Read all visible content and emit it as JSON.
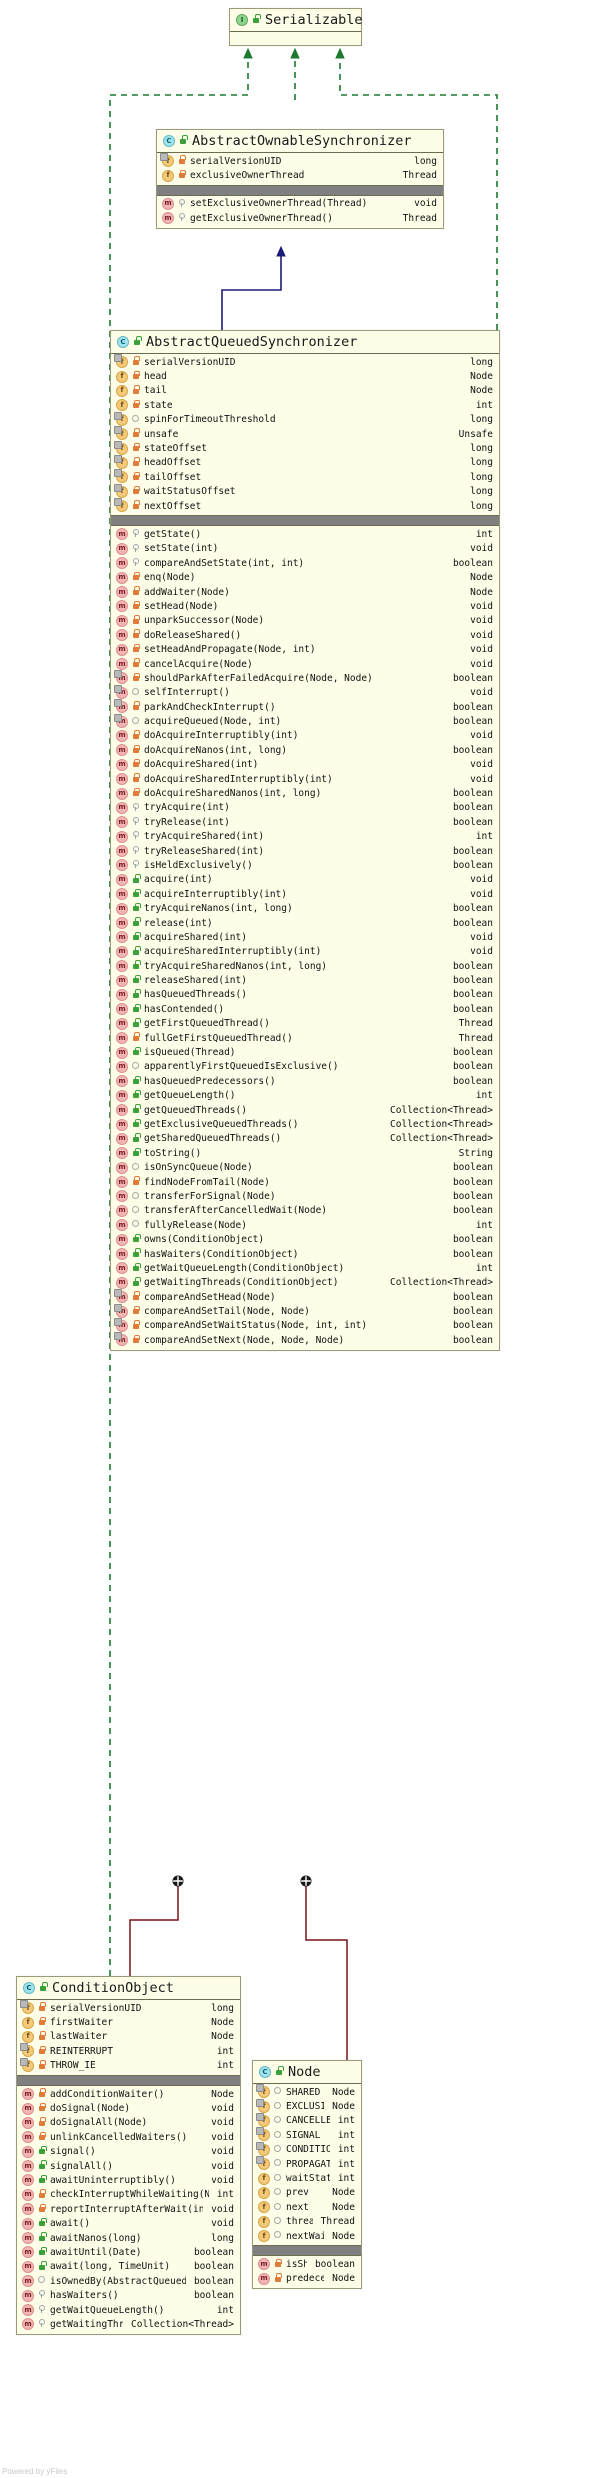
{
  "diagram": {
    "watermark": "Powered by yFiles"
  },
  "classes": {
    "serializable": {
      "name": "Serializable",
      "kind": "interface",
      "visibility": "public",
      "fields": [],
      "methods": []
    },
    "aos": {
      "name": "AbstractOwnableSynchronizer",
      "kind": "class",
      "visibility": "public",
      "fields": [
        {
          "name": "serialVersionUID",
          "type": "long",
          "visibility": "private",
          "static": true
        },
        {
          "name": "exclusiveOwnerThread",
          "type": "Thread",
          "visibility": "private",
          "static": false
        }
      ],
      "methods": [
        {
          "name": "setExclusiveOwnerThread(Thread)",
          "type": "void",
          "visibility": "protected",
          "static": false
        },
        {
          "name": "getExclusiveOwnerThread()",
          "type": "Thread",
          "visibility": "protected",
          "static": false
        }
      ]
    },
    "aqs": {
      "name": "AbstractQueuedSynchronizer",
      "kind": "class",
      "visibility": "public",
      "fields": [
        {
          "name": "serialVersionUID",
          "type": "long",
          "visibility": "private",
          "static": true
        },
        {
          "name": "head",
          "type": "Node",
          "visibility": "private",
          "static": false
        },
        {
          "name": "tail",
          "type": "Node",
          "visibility": "private",
          "static": false
        },
        {
          "name": "state",
          "type": "int",
          "visibility": "private",
          "static": false
        },
        {
          "name": "spinForTimeoutThreshold",
          "type": "long",
          "visibility": "package",
          "static": true
        },
        {
          "name": "unsafe",
          "type": "Unsafe",
          "visibility": "private",
          "static": true
        },
        {
          "name": "stateOffset",
          "type": "long",
          "visibility": "private",
          "static": true
        },
        {
          "name": "headOffset",
          "type": "long",
          "visibility": "private",
          "static": true
        },
        {
          "name": "tailOffset",
          "type": "long",
          "visibility": "private",
          "static": true
        },
        {
          "name": "waitStatusOffset",
          "type": "long",
          "visibility": "private",
          "static": true
        },
        {
          "name": "nextOffset",
          "type": "long",
          "visibility": "private",
          "static": true
        }
      ],
      "methods": [
        {
          "name": "getState()",
          "type": "int",
          "visibility": "protected",
          "static": false
        },
        {
          "name": "setState(int)",
          "type": "void",
          "visibility": "protected",
          "static": false
        },
        {
          "name": "compareAndSetState(int, int)",
          "type": "boolean",
          "visibility": "protected",
          "static": false
        },
        {
          "name": "enq(Node)",
          "type": "Node",
          "visibility": "private",
          "static": false
        },
        {
          "name": "addWaiter(Node)",
          "type": "Node",
          "visibility": "private",
          "static": false
        },
        {
          "name": "setHead(Node)",
          "type": "void",
          "visibility": "private",
          "static": false
        },
        {
          "name": "unparkSuccessor(Node)",
          "type": "void",
          "visibility": "private",
          "static": false
        },
        {
          "name": "doReleaseShared()",
          "type": "void",
          "visibility": "private",
          "static": false
        },
        {
          "name": "setHeadAndPropagate(Node, int)",
          "type": "void",
          "visibility": "private",
          "static": false
        },
        {
          "name": "cancelAcquire(Node)",
          "type": "void",
          "visibility": "private",
          "static": false
        },
        {
          "name": "shouldParkAfterFailedAcquire(Node, Node)",
          "type": "boolean",
          "visibility": "private",
          "static": true
        },
        {
          "name": "selfInterrupt()",
          "type": "void",
          "visibility": "package",
          "static": true
        },
        {
          "name": "parkAndCheckInterrupt()",
          "type": "boolean",
          "visibility": "private",
          "static": true
        },
        {
          "name": "acquireQueued(Node, int)",
          "type": "boolean",
          "visibility": "package",
          "static": true
        },
        {
          "name": "doAcquireInterruptibly(int)",
          "type": "void",
          "visibility": "private",
          "static": false
        },
        {
          "name": "doAcquireNanos(int, long)",
          "type": "boolean",
          "visibility": "private",
          "static": false
        },
        {
          "name": "doAcquireShared(int)",
          "type": "void",
          "visibility": "private",
          "static": false
        },
        {
          "name": "doAcquireSharedInterruptibly(int)",
          "type": "void",
          "visibility": "private",
          "static": false
        },
        {
          "name": "doAcquireSharedNanos(int, long)",
          "type": "boolean",
          "visibility": "private",
          "static": false
        },
        {
          "name": "tryAcquire(int)",
          "type": "boolean",
          "visibility": "protected",
          "static": false
        },
        {
          "name": "tryRelease(int)",
          "type": "boolean",
          "visibility": "protected",
          "static": false
        },
        {
          "name": "tryAcquireShared(int)",
          "type": "int",
          "visibility": "protected",
          "static": false
        },
        {
          "name": "tryReleaseShared(int)",
          "type": "boolean",
          "visibility": "protected",
          "static": false
        },
        {
          "name": "isHeldExclusively()",
          "type": "boolean",
          "visibility": "protected",
          "static": false
        },
        {
          "name": "acquire(int)",
          "type": "void",
          "visibility": "public",
          "static": false
        },
        {
          "name": "acquireInterruptibly(int)",
          "type": "void",
          "visibility": "public",
          "static": false
        },
        {
          "name": "tryAcquireNanos(int, long)",
          "type": "boolean",
          "visibility": "public",
          "static": false
        },
        {
          "name": "release(int)",
          "type": "boolean",
          "visibility": "public",
          "static": false
        },
        {
          "name": "acquireShared(int)",
          "type": "void",
          "visibility": "public",
          "static": false
        },
        {
          "name": "acquireSharedInterruptibly(int)",
          "type": "void",
          "visibility": "public",
          "static": false
        },
        {
          "name": "tryAcquireSharedNanos(int, long)",
          "type": "boolean",
          "visibility": "public",
          "static": false
        },
        {
          "name": "releaseShared(int)",
          "type": "boolean",
          "visibility": "public",
          "static": false
        },
        {
          "name": "hasQueuedThreads()",
          "type": "boolean",
          "visibility": "public",
          "static": false
        },
        {
          "name": "hasContended()",
          "type": "boolean",
          "visibility": "public",
          "static": false
        },
        {
          "name": "getFirstQueuedThread()",
          "type": "Thread",
          "visibility": "public",
          "static": false
        },
        {
          "name": "fullGetFirstQueuedThread()",
          "type": "Thread",
          "visibility": "private",
          "static": false
        },
        {
          "name": "isQueued(Thread)",
          "type": "boolean",
          "visibility": "public",
          "static": false
        },
        {
          "name": "apparentlyFirstQueuedIsExclusive()",
          "type": "boolean",
          "visibility": "package",
          "static": false
        },
        {
          "name": "hasQueuedPredecessors()",
          "type": "boolean",
          "visibility": "public",
          "static": false
        },
        {
          "name": "getQueueLength()",
          "type": "int",
          "visibility": "public",
          "static": false
        },
        {
          "name": "getQueuedThreads()",
          "type": "Collection<Thread>",
          "visibility": "public",
          "static": false
        },
        {
          "name": "getExclusiveQueuedThreads()",
          "type": "Collection<Thread>",
          "visibility": "public",
          "static": false
        },
        {
          "name": "getSharedQueuedThreads()",
          "type": "Collection<Thread>",
          "visibility": "public",
          "static": false
        },
        {
          "name": "toString()",
          "type": "String",
          "visibility": "public",
          "static": false
        },
        {
          "name": "isOnSyncQueue(Node)",
          "type": "boolean",
          "visibility": "package",
          "static": false
        },
        {
          "name": "findNodeFromTail(Node)",
          "type": "boolean",
          "visibility": "private",
          "static": false
        },
        {
          "name": "transferForSignal(Node)",
          "type": "boolean",
          "visibility": "package",
          "static": false
        },
        {
          "name": "transferAfterCancelledWait(Node)",
          "type": "boolean",
          "visibility": "package",
          "static": false
        },
        {
          "name": "fullyRelease(Node)",
          "type": "int",
          "visibility": "package",
          "static": false
        },
        {
          "name": "owns(ConditionObject)",
          "type": "boolean",
          "visibility": "public",
          "static": false
        },
        {
          "name": "hasWaiters(ConditionObject)",
          "type": "boolean",
          "visibility": "public",
          "static": false
        },
        {
          "name": "getWaitQueueLength(ConditionObject)",
          "type": "int",
          "visibility": "public",
          "static": false
        },
        {
          "name": "getWaitingThreads(ConditionObject)",
          "type": "Collection<Thread>",
          "visibility": "public",
          "static": false
        },
        {
          "name": "compareAndSetHead(Node)",
          "type": "boolean",
          "visibility": "private",
          "static": true
        },
        {
          "name": "compareAndSetTail(Node, Node)",
          "type": "boolean",
          "visibility": "private",
          "static": true
        },
        {
          "name": "compareAndSetWaitStatus(Node, int, int)",
          "type": "boolean",
          "visibility": "private",
          "static": true
        },
        {
          "name": "compareAndSetNext(Node, Node, Node)",
          "type": "boolean",
          "visibility": "private",
          "static": true
        }
      ]
    },
    "conditionObject": {
      "name": "ConditionObject",
      "kind": "class",
      "visibility": "public",
      "fields": [
        {
          "name": "serialVersionUID",
          "type": "long",
          "visibility": "private",
          "static": true
        },
        {
          "name": "firstWaiter",
          "type": "Node",
          "visibility": "private",
          "static": false
        },
        {
          "name": "lastWaiter",
          "type": "Node",
          "visibility": "private",
          "static": false
        },
        {
          "name": "REINTERRUPT",
          "type": "int",
          "visibility": "private",
          "static": true
        },
        {
          "name": "THROW_IE",
          "type": "int",
          "visibility": "private",
          "static": true
        }
      ],
      "methods": [
        {
          "name": "addConditionWaiter()",
          "type": "Node",
          "visibility": "private",
          "static": false
        },
        {
          "name": "doSignal(Node)",
          "type": "void",
          "visibility": "private",
          "static": false
        },
        {
          "name": "doSignalAll(Node)",
          "type": "void",
          "visibility": "private",
          "static": false
        },
        {
          "name": "unlinkCancelledWaiters()",
          "type": "void",
          "visibility": "private",
          "static": false
        },
        {
          "name": "signal()",
          "type": "void",
          "visibility": "public",
          "static": false
        },
        {
          "name": "signalAll()",
          "type": "void",
          "visibility": "public",
          "static": false
        },
        {
          "name": "awaitUninterruptibly()",
          "type": "void",
          "visibility": "public",
          "static": false
        },
        {
          "name": "checkInterruptWhileWaiting(Node)",
          "type": "int",
          "visibility": "private",
          "static": false
        },
        {
          "name": "reportInterruptAfterWait(int)",
          "type": "void",
          "visibility": "private",
          "static": false
        },
        {
          "name": "await()",
          "type": "void",
          "visibility": "public",
          "static": false
        },
        {
          "name": "awaitNanos(long)",
          "type": "long",
          "visibility": "public",
          "static": false
        },
        {
          "name": "awaitUntil(Date)",
          "type": "boolean",
          "visibility": "public",
          "static": false
        },
        {
          "name": "await(long, TimeUnit)",
          "type": "boolean",
          "visibility": "public",
          "static": false
        },
        {
          "name": "isOwnedBy(AbstractQueuedSynchronizer)",
          "type": "boolean",
          "visibility": "package",
          "static": false
        },
        {
          "name": "hasWaiters()",
          "type": "boolean",
          "visibility": "protected",
          "static": false
        },
        {
          "name": "getWaitQueueLength()",
          "type": "int",
          "visibility": "protected",
          "static": false
        },
        {
          "name": "getWaitingThreads()",
          "type": "Collection<Thread>",
          "visibility": "protected",
          "static": false
        }
      ]
    },
    "node": {
      "name": "Node",
      "kind": "class",
      "visibility": "public",
      "fields": [
        {
          "name": "SHARED",
          "type": "Node",
          "visibility": "package",
          "static": true
        },
        {
          "name": "EXCLUSIVE",
          "type": "Node",
          "visibility": "package",
          "static": true
        },
        {
          "name": "CANCELLED",
          "type": "int",
          "visibility": "package",
          "static": true
        },
        {
          "name": "SIGNAL",
          "type": "int",
          "visibility": "package",
          "static": true
        },
        {
          "name": "CONDITION",
          "type": "int",
          "visibility": "package",
          "static": true
        },
        {
          "name": "PROPAGATE",
          "type": "int",
          "visibility": "package",
          "static": true
        },
        {
          "name": "waitStatus",
          "type": "int",
          "visibility": "package",
          "static": false
        },
        {
          "name": "prev",
          "type": "Node",
          "visibility": "package",
          "static": false
        },
        {
          "name": "next",
          "type": "Node",
          "visibility": "package",
          "static": false
        },
        {
          "name": "thread",
          "type": "Thread",
          "visibility": "package",
          "static": false
        },
        {
          "name": "nextWaiter",
          "type": "Node",
          "visibility": "package",
          "static": false
        }
      ],
      "methods": [
        {
          "name": "isShared()",
          "type": "boolean",
          "visibility": "private",
          "static": false
        },
        {
          "name": "predecessor()",
          "type": "Node",
          "visibility": "private",
          "static": false
        }
      ]
    }
  },
  "relations": [
    {
      "from": "aos",
      "to": "serializable",
      "type": "realization"
    },
    {
      "from": "aqs",
      "to": "serializable",
      "type": "realization"
    },
    {
      "from": "conditionObject",
      "to": "serializable",
      "type": "realization"
    },
    {
      "from": "aqs",
      "to": "aos",
      "type": "generalization"
    },
    {
      "from": "aqs",
      "to": "conditionObject",
      "type": "composition"
    },
    {
      "from": "aqs",
      "to": "node",
      "type": "composition"
    }
  ]
}
